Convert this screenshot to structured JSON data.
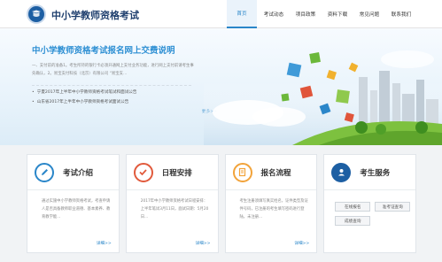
{
  "header": {
    "site_title": "中小学教师资格考试",
    "nav": [
      "首页",
      "考试动态",
      "项目政策",
      "资料下载",
      "常见问题",
      "联系我们"
    ]
  },
  "banner": {
    "title": "中小学教师资格考试报名网上交费说明",
    "text": "一、支付前的准备1。考生所持的银行卡必须开通网上支付业务功能，进行网上支付前请考生事先确认，2。易宝支付科技（北京）有限公司 “易宝支...",
    "news": [
      "宁夏2017年上半年中小学教师资格考试笔试和面试公告",
      "山东省2017年上半年中小学教师资格考试面试公告"
    ],
    "more": "更多>>"
  },
  "cards": [
    {
      "title": "考试介绍",
      "text": "通过实施中小学教师资格考试，考查申请人是否具备教师职业道德、基本素养、教育教学能...",
      "more": "详细>>"
    },
    {
      "title": "日程安排",
      "text": "2017年中小学教师资格考试日程安排：上半年笔试3月11日，面试日期：5月20日...",
      "more": "详细>>"
    },
    {
      "title": "报名流程",
      "text": "考生注册须填写真实姓名，证件类型及证件号码，已注册的考生填写密码进行登陆，未注册...",
      "more": "详细>>"
    },
    {
      "title": "考生服务",
      "buttons": [
        "在线报名",
        "准考证查询",
        "成绩查询"
      ]
    }
  ],
  "colors": {
    "brand": "#2a86c9",
    "card_blue": "#2a86c9",
    "card_red": "#e15a3c",
    "card_orange": "#f2a33a",
    "card_darkblue": "#1d5fa3"
  }
}
